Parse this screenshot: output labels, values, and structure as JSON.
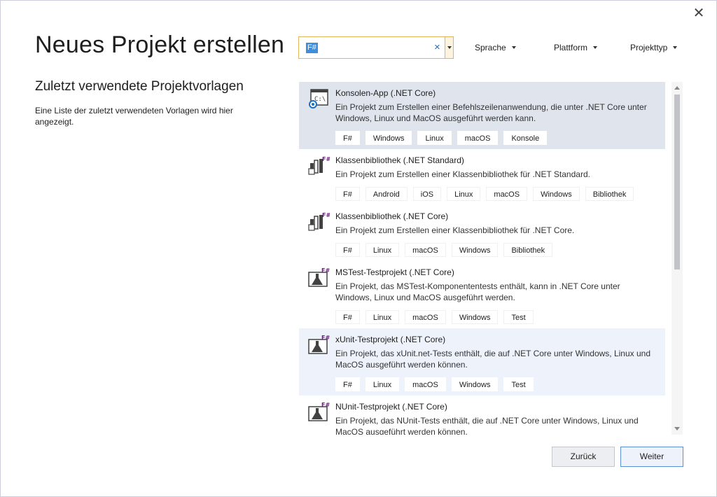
{
  "dialog": {
    "close_glyph": "✕",
    "title": "Neues Projekt erstellen"
  },
  "left": {
    "heading": "Zuletzt verwendete Projektvorlagen",
    "description": "Eine Liste der zuletzt verwendeten Vorlagen wird hier angezeigt."
  },
  "search": {
    "value": "F#",
    "placeholder": "",
    "clear_glyph": "×"
  },
  "filters": {
    "language": "Sprache",
    "platform": "Plattform",
    "project_type": "Projekttyp"
  },
  "templates": [
    {
      "title": "Konsolen-App (.NET Core)",
      "description": "Ein Projekt zum Erstellen einer Befehlszeilenanwendung, die unter .NET Core unter Windows, Linux und MacOS ausgeführt werden kann.",
      "tags": [
        "F#",
        "Windows",
        "Linux",
        "macOS",
        "Konsole"
      ],
      "icon": "console-app-icon",
      "state": "selected"
    },
    {
      "title": "Klassenbibliothek (.NET Standard)",
      "description": "Ein Projekt zum Erstellen einer Klassenbibliothek für .NET Standard.",
      "tags": [
        "F#",
        "Android",
        "iOS",
        "Linux",
        "macOS",
        "Windows",
        "Bibliothek"
      ],
      "icon": "class-library-icon",
      "state": "normal"
    },
    {
      "title": "Klassenbibliothek (.NET Core)",
      "description": "Ein Projekt zum Erstellen einer Klassenbibliothek für .NET Core.",
      "tags": [
        "F#",
        "Linux",
        "macOS",
        "Windows",
        "Bibliothek"
      ],
      "icon": "class-library-icon",
      "state": "normal"
    },
    {
      "title": "MSTest-Testprojekt (.NET Core)",
      "description": "Ein Projekt, das MSTest-Komponententests enthält, kann in .NET Core unter Windows, Linux und MacOS ausgeführt werden.",
      "tags": [
        "F#",
        "Linux",
        "macOS",
        "Windows",
        "Test"
      ],
      "icon": "test-project-icon",
      "state": "normal"
    },
    {
      "title": "xUnit-Testprojekt (.NET Core)",
      "description": "Ein Projekt, das xUnit.net-Tests enthält, die auf .NET Core unter Windows, Linux und MacOS ausgeführt werden können.",
      "tags": [
        "F#",
        "Linux",
        "macOS",
        "Windows",
        "Test"
      ],
      "icon": "test-project-icon",
      "state": "hover"
    },
    {
      "title": "NUnit-Testprojekt (.NET Core)",
      "description": "Ein Projekt, das NUnit-Tests enthält, die auf .NET Core unter Windows, Linux und MacOS ausgeführt werden können.",
      "tags": [],
      "icon": "test-project-icon",
      "state": "normal"
    }
  ],
  "buttons": {
    "back": "Zurück",
    "next": "Weiter"
  },
  "colors": {
    "selected_row": "#dfe4ed",
    "hover_row": "#eef3fb",
    "search_border": "#e2b55c",
    "accent": "#3e8ee0",
    "fsharp_purple": "#68217a"
  }
}
